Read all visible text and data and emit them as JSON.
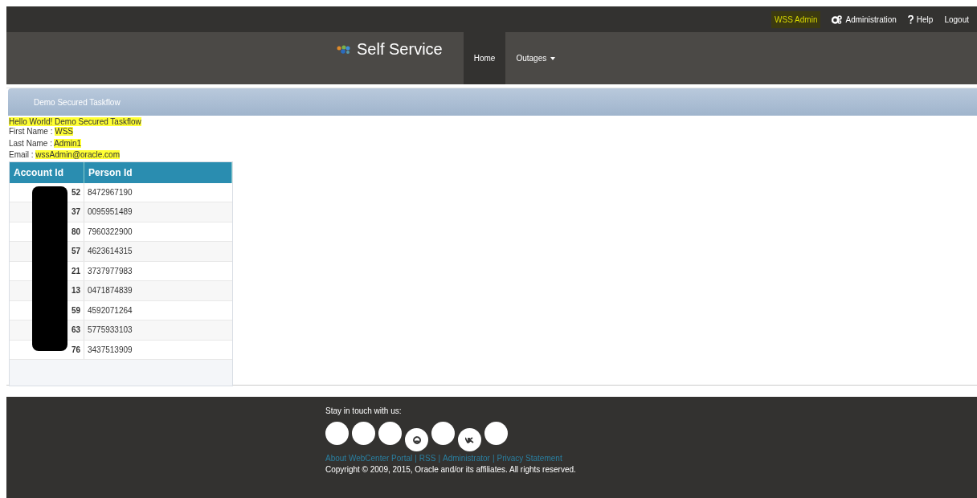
{
  "top_bar": {
    "user": "WSS Admin",
    "links": [
      {
        "kind": "admin",
        "label": "Administration"
      },
      {
        "kind": "help",
        "label": "Help"
      },
      {
        "kind": "plain",
        "label": "Logout"
      }
    ]
  },
  "header": {
    "title": "Self Service",
    "nav": [
      {
        "label": "Home",
        "selected": true,
        "dropdown": false
      },
      {
        "label": "Outages",
        "selected": false,
        "dropdown": true
      }
    ]
  },
  "section": {
    "title": "Demo Secured Taskflow"
  },
  "greeting": "Hello World! Demo Secured Taskflow",
  "fields": [
    {
      "label": "First Name :",
      "value": "WSS"
    },
    {
      "label": "Last Name :",
      "value": "Admin1"
    },
    {
      "label": "Email :",
      "value": "wssAdmin@oracle.com"
    }
  ],
  "table": {
    "columns": [
      "Account Id",
      "Person Id"
    ],
    "rows": [
      [
        "52",
        "8472967190"
      ],
      [
        "37",
        "0095951489"
      ],
      [
        "80",
        "7960322900"
      ],
      [
        "57",
        "4623614315"
      ],
      [
        "21",
        "3737977983"
      ],
      [
        "13",
        "0471874839"
      ],
      [
        "59",
        "4592071264"
      ],
      [
        "63",
        "5775933103"
      ],
      [
        "76",
        "3437513909"
      ]
    ]
  },
  "footer": {
    "heading": "Stay in touch with us:",
    "links": [
      "About WebCenter Portal",
      "RSS",
      "Administrator",
      "Privacy Statement"
    ],
    "separator": "|",
    "copyright": "Copyright © 2009, 2015, Oracle and/or its affiliates. All rights reserved."
  }
}
